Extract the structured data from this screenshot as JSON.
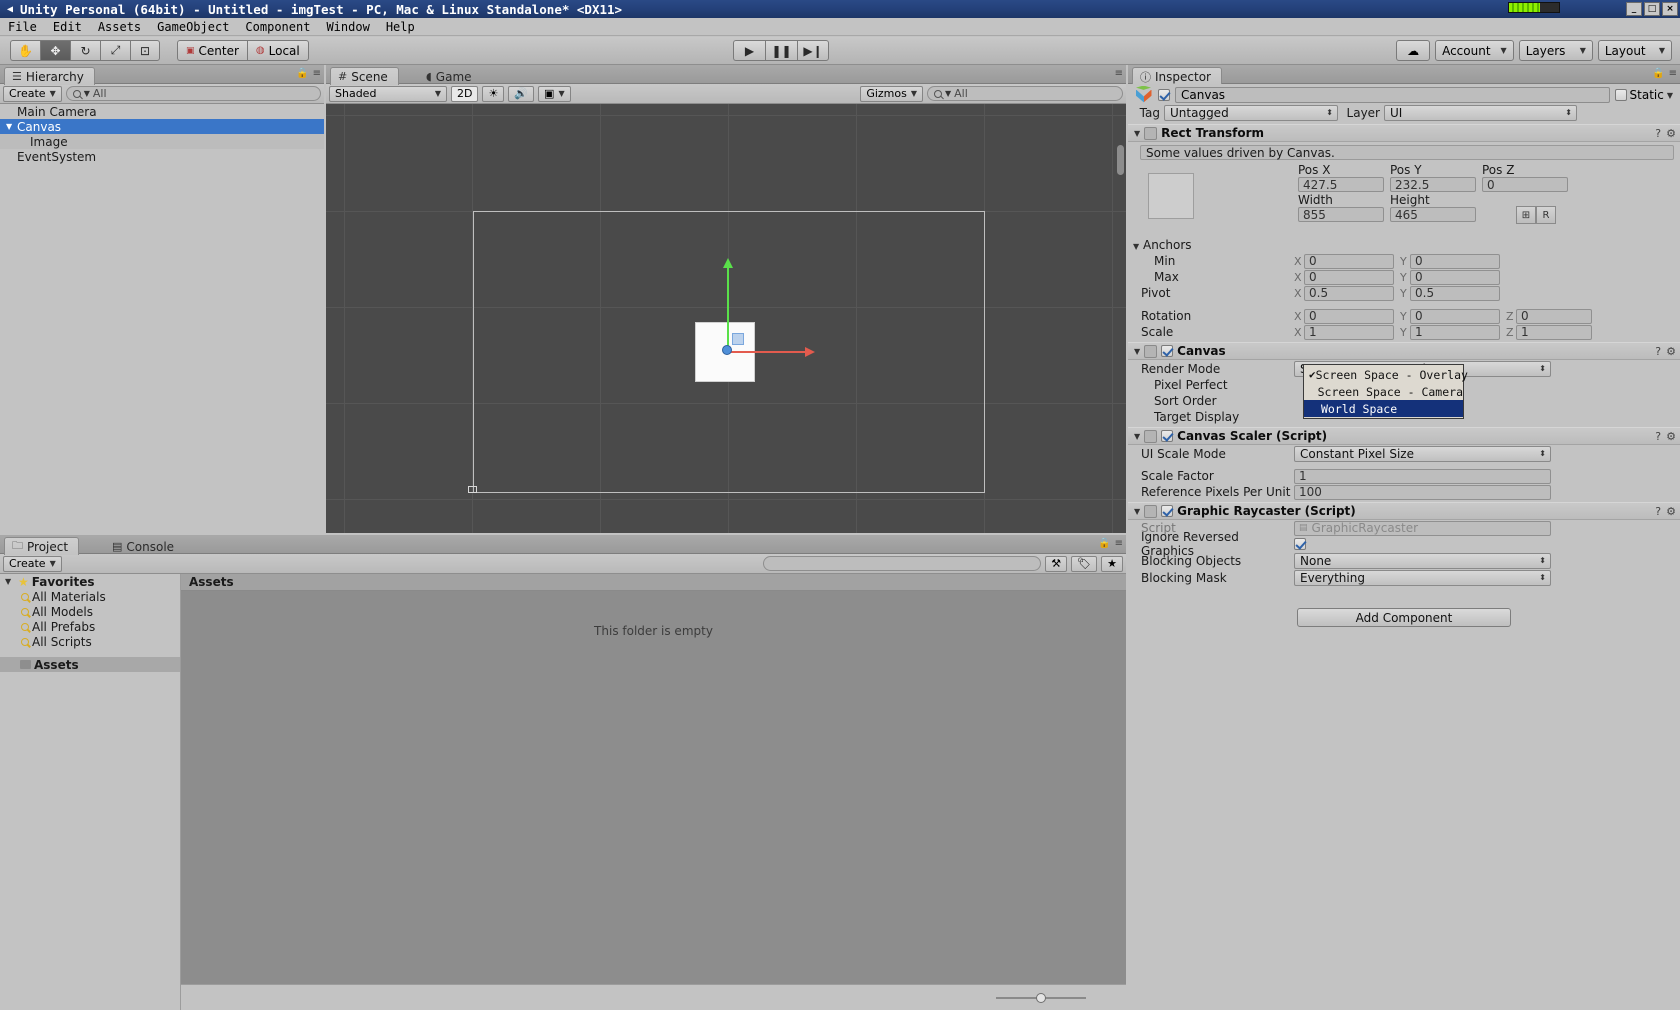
{
  "window": {
    "title": "Unity Personal (64bit) - Untitled - imgTest - PC, Mac & Linux Standalone* <DX11>",
    "app_icon": "unity-icon",
    "minimize": "_",
    "maximize": "□",
    "close": "×"
  },
  "menubar": {
    "items": [
      "File",
      "Edit",
      "Assets",
      "GameObject",
      "Component",
      "Window",
      "Help"
    ]
  },
  "toolbar": {
    "transform_tools": [
      {
        "name": "hand-tool",
        "glyph": "✋",
        "active": false
      },
      {
        "name": "move-tool",
        "glyph": "✥",
        "active": true
      },
      {
        "name": "rotate-tool",
        "glyph": "↻",
        "active": false
      },
      {
        "name": "scale-tool",
        "glyph": "⤢",
        "active": false
      },
      {
        "name": "rect-tool",
        "glyph": "⊡",
        "active": false
      }
    ],
    "pivot_label": "Center",
    "pivot_icon": "pivot-icon",
    "space_label": "Local",
    "space_icon": "globe-icon",
    "play_controls": [
      {
        "name": "play-button",
        "glyph": "▶"
      },
      {
        "name": "pause-button",
        "glyph": "❚❚"
      },
      {
        "name": "step-button",
        "glyph": "▶❙"
      }
    ],
    "cloud_icon": "cloud-icon",
    "account_label": "Account",
    "layers_label": "Layers",
    "layout_label": "Layout"
  },
  "hierarchy": {
    "tab_label": "Hierarchy",
    "tab_icon": "hierarchy-icon",
    "create_label": "Create",
    "search_placeholder": "All",
    "items": [
      {
        "name": "Main Camera",
        "depth": 0,
        "expandable": false,
        "selected": false
      },
      {
        "name": "Canvas",
        "depth": 0,
        "expandable": true,
        "selected": true
      },
      {
        "name": "Image",
        "depth": 1,
        "expandable": false,
        "selected": false
      },
      {
        "name": "EventSystem",
        "depth": 0,
        "expandable": false,
        "selected": false
      }
    ]
  },
  "scene": {
    "tab_scene": "Scene",
    "tab_game": "Game",
    "shading_mode": "Shaded",
    "toggle_2d": "2D",
    "lighting_icon": "sun-icon",
    "audio_icon": "speaker-icon",
    "effects_icon": "image-icon",
    "gizmos_label": "Gizmos",
    "search_placeholder": "All"
  },
  "project": {
    "tab_project": "Project",
    "tab_console": "Console",
    "create_label": "Create",
    "favorites_label": "Favorites",
    "favorites": [
      "All Materials",
      "All Models",
      "All Prefabs",
      "All Scripts"
    ],
    "assets_tree_label": "Assets",
    "assets_header": "Assets",
    "empty_message": "This folder is empty",
    "search_placeholder": ""
  },
  "inspector": {
    "tab_label": "Inspector",
    "tab_icon": "info-icon",
    "object_name": "Canvas",
    "object_enabled": true,
    "static_label": "Static",
    "static_checked": false,
    "tag_label": "Tag",
    "tag_value": "Untagged",
    "layer_label": "Layer",
    "layer_value": "UI",
    "rect_transform": {
      "title": "Rect Transform",
      "icon": "rect-transform-icon",
      "note": "Some values driven by Canvas.",
      "pos_x_label": "Pos X",
      "pos_y_label": "Pos Y",
      "pos_z_label": "Pos Z",
      "pos_x": "427.5",
      "pos_y": "232.5",
      "pos_z": "0",
      "width_label": "Width",
      "height_label": "Height",
      "width": "855",
      "height": "465",
      "anchors_label": "Anchors",
      "min_label": "Min",
      "min_x": "0",
      "min_y": "0",
      "max_label": "Max",
      "max_x": "0",
      "max_y": "0",
      "pivot_label": "Pivot",
      "pivot_x": "0.5",
      "pivot_y": "0.5",
      "rotation_label": "Rotation",
      "rot_x": "0",
      "rot_y": "0",
      "rot_z": "0",
      "scale_label": "Scale",
      "scale_x": "1",
      "scale_y": "1",
      "scale_z": "1",
      "blueprint_btn": "⊞",
      "raw_btn": "R"
    },
    "canvas": {
      "title": "Canvas",
      "enabled": true,
      "render_mode_label": "Render Mode",
      "render_mode_value": "Screen Space - Overlay",
      "pixel_perfect_label": "Pixel Perfect",
      "sort_order_label": "Sort Order",
      "target_display_label": "Target Display"
    },
    "canvas_scaler": {
      "title": "Canvas Scaler (Script)",
      "enabled": true,
      "ui_scale_mode_label": "UI Scale Mode",
      "ui_scale_mode_value": "Constant Pixel Size",
      "scale_factor_label": "Scale Factor",
      "scale_factor_value": "1",
      "ref_ppu_label": "Reference Pixels Per Unit",
      "ref_ppu_value": "100"
    },
    "graphic_raycaster": {
      "title": "Graphic Raycaster (Script)",
      "enabled": true,
      "script_label": "Script",
      "script_value": "GraphicRaycaster",
      "ignore_reversed_label": "Ignore Reversed Graphics",
      "ignore_reversed_checked": true,
      "blocking_objects_label": "Blocking Objects",
      "blocking_objects_value": "None",
      "blocking_mask_label": "Blocking Mask",
      "blocking_mask_value": "Everything"
    },
    "add_component_label": "Add Component"
  },
  "render_mode_dropdown": {
    "open": true,
    "options": [
      {
        "label": "Screen Space - Overlay",
        "checked": true,
        "highlighted": false
      },
      {
        "label": "Screen Space - Camera",
        "checked": false,
        "highlighted": false
      },
      {
        "label": "World Space",
        "checked": false,
        "highlighted": true
      }
    ]
  },
  "colors": {
    "selection_blue": "#3a76c8",
    "menu_highlight": "#14317a",
    "panel_gray": "#c3c3c3",
    "scene_bg": "#4a4a4a",
    "gizmo_green": "#5ae04a",
    "gizmo_red": "#e35b4e",
    "gizmo_blue": "#4f8fd8"
  }
}
